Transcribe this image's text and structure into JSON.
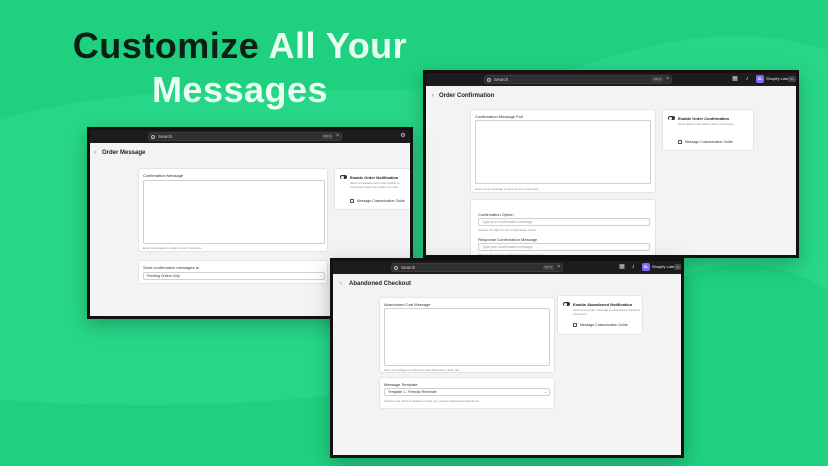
{
  "headline": {
    "word1": "Customize",
    "word2": "All Your",
    "word3": "Messages"
  },
  "colors": {
    "background": "#1fd07f",
    "dark_text": "#0b1f16",
    "light_text": "#e9fff3",
    "avatar": "#7b6cf6"
  },
  "common": {
    "search_placeholder": "Search",
    "search_shortcut": "Ctrl K",
    "close_glyph": "×",
    "store_initials": "SL",
    "store_name": "Shopify Latest",
    "store_pill": "SL",
    "back_glyph": "‹",
    "guide_label": "Message Customization Guide"
  },
  "win_order_message": {
    "title": "Order Message",
    "field_label": "Confirmation Message",
    "field_hint": "Enter a message to send to your customers.",
    "send_label": "Send confirmation messages to",
    "send_value": "Pending Orders Only",
    "toggle_title": "Enable Order Notification",
    "toggle_desc": "Send a message with order details to customers when they place an order."
  },
  "win_order_confirmation": {
    "title": "Order Confirmation",
    "field_label": "Confirmation Message Poll",
    "field_hint": "Enter a poll message to send to your customers.",
    "option_label": "Confirmation Option",
    "option_placeholder": "Type your confirmation message",
    "option_hint": "Choose the label for the confirmation option.",
    "response_label": "Response Confirmation Message",
    "response_placeholder": "Type your confirmation message",
    "response_hint": "Choose the response of the confirmation message.",
    "toggle_title": "Enable Order Confirmation",
    "toggle_desc": "Send order confirmation poll to customers."
  },
  "win_abandoned": {
    "title": "Abandoned Checkout",
    "field_label": "Abandoned Cart Message",
    "field_hint": "Send a message to customers who left items in their cart.",
    "template_label": "Message Template",
    "template_value": "Template 1 - Friendly Reminder",
    "template_hint": "Choose one of the templates to help you recover abandoned checkouts.",
    "toggle_title": "Enable Abandoned Notification",
    "toggle_desc": "Send a reminder message to abandoned checkout customers."
  }
}
